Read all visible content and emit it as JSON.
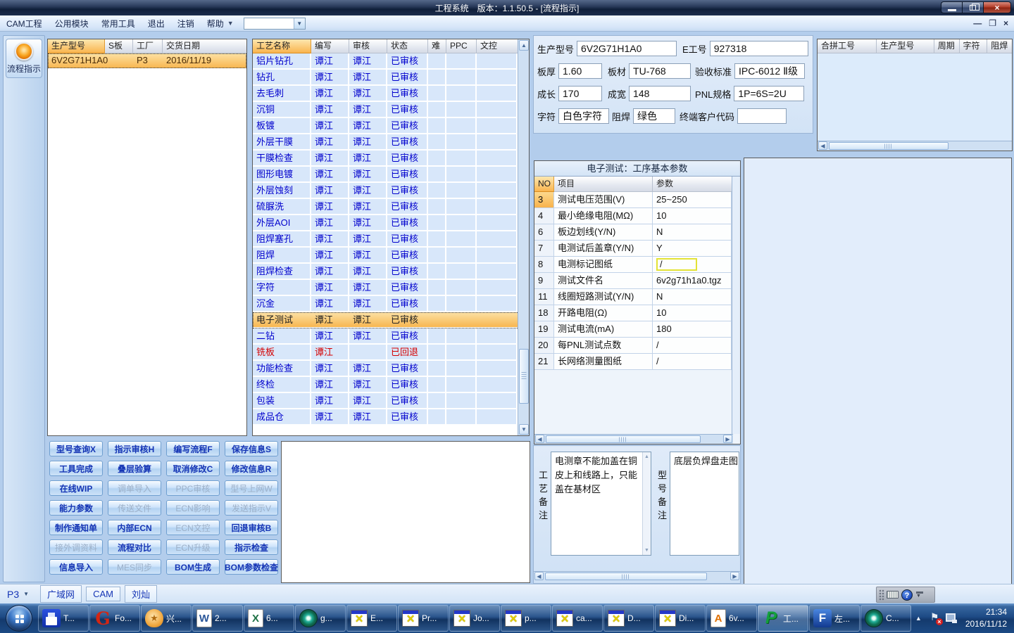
{
  "titlebar": {
    "title": "工程系统　版本：1.1.50.5 - [流程指示]"
  },
  "menubar": {
    "items": [
      "CAM工程",
      "公用模块",
      "常用工具",
      "退出",
      "注销",
      "帮助"
    ]
  },
  "sidebar": {
    "flow_label": "流程指示"
  },
  "model_table": {
    "headers": [
      "生产型号",
      "S板",
      "工厂",
      "交货日期"
    ],
    "row": {
      "model": "6V2G71H1A0",
      "sboard": "",
      "factory": "P3",
      "date": "2016/11/19"
    }
  },
  "process_table": {
    "headers": [
      "工艺名称",
      "编写",
      "审核",
      "状态",
      "难",
      "PPC",
      "文控"
    ],
    "rows": [
      {
        "name": "铝片钻孔",
        "writer": "谭江",
        "auditor": "谭江",
        "status": "已审核",
        "state": "normal"
      },
      {
        "name": "钻孔",
        "writer": "谭江",
        "auditor": "谭江",
        "status": "已审核",
        "state": "normal"
      },
      {
        "name": "去毛刺",
        "writer": "谭江",
        "auditor": "谭江",
        "status": "已审核",
        "state": "normal"
      },
      {
        "name": "沉铜",
        "writer": "谭江",
        "auditor": "谭江",
        "status": "已审核",
        "state": "normal"
      },
      {
        "name": "板镀",
        "writer": "谭江",
        "auditor": "谭江",
        "status": "已审核",
        "state": "normal"
      },
      {
        "name": "外层干膜",
        "writer": "谭江",
        "auditor": "谭江",
        "status": "已审核",
        "state": "normal"
      },
      {
        "name": "干膜检查",
        "writer": "谭江",
        "auditor": "谭江",
        "status": "已审核",
        "state": "normal"
      },
      {
        "name": "图形电镀",
        "writer": "谭江",
        "auditor": "谭江",
        "status": "已审核",
        "state": "normal"
      },
      {
        "name": "外层蚀刻",
        "writer": "谭江",
        "auditor": "谭江",
        "status": "已审核",
        "state": "normal"
      },
      {
        "name": "硫脲洗",
        "writer": "谭江",
        "auditor": "谭江",
        "status": "已审核",
        "state": "normal"
      },
      {
        "name": "外层AOI",
        "writer": "谭江",
        "auditor": "谭江",
        "status": "已审核",
        "state": "normal"
      },
      {
        "name": "阻焊塞孔",
        "writer": "谭江",
        "auditor": "谭江",
        "status": "已审核",
        "state": "normal"
      },
      {
        "name": "阻焊",
        "writer": "谭江",
        "auditor": "谭江",
        "status": "已审核",
        "state": "normal"
      },
      {
        "name": "阻焊检查",
        "writer": "谭江",
        "auditor": "谭江",
        "status": "已审核",
        "state": "normal"
      },
      {
        "name": "字符",
        "writer": "谭江",
        "auditor": "谭江",
        "status": "已审核",
        "state": "normal"
      },
      {
        "name": "沉金",
        "writer": "谭江",
        "auditor": "谭江",
        "status": "已审核",
        "state": "normal"
      },
      {
        "name": "电子测试",
        "writer": "谭江",
        "auditor": "谭江",
        "status": "已审核",
        "state": "selected"
      },
      {
        "name": "二钻",
        "writer": "谭江",
        "auditor": "谭江",
        "status": "已审核",
        "state": "normal"
      },
      {
        "name": "铣板",
        "writer": "谭江",
        "auditor": "",
        "status": "已回退",
        "state": "rejected"
      },
      {
        "name": "功能检查",
        "writer": "谭江",
        "auditor": "谭江",
        "status": "已审核",
        "state": "normal"
      },
      {
        "name": "终检",
        "writer": "谭江",
        "auditor": "谭江",
        "status": "已审核",
        "state": "normal"
      },
      {
        "name": "包装",
        "writer": "谭江",
        "auditor": "谭江",
        "status": "已审核",
        "state": "normal"
      },
      {
        "name": "成品仓",
        "writer": "谭江",
        "auditor": "谭江",
        "status": "已审核",
        "state": "normal"
      }
    ]
  },
  "info_panel": {
    "fields": [
      {
        "label": "生产型号",
        "value": "6V2G71H1A0"
      },
      {
        "label": "E工号",
        "value": "927318"
      },
      {
        "label": "板厚",
        "value": "1.60"
      },
      {
        "label": "板材",
        "value": "TU-768"
      },
      {
        "label": "验收标准",
        "value": "IPC-6012 Ⅱ级"
      },
      {
        "label": "成长",
        "value": "170"
      },
      {
        "label": "成宽",
        "value": "148"
      },
      {
        "label": "PNL规格",
        "value": "1P=6S=2U"
      },
      {
        "label": "字符",
        "value": "白色字符"
      },
      {
        "label": "阻焊",
        "value": "绿色"
      },
      {
        "label": "终端客户代码",
        "value": ""
      }
    ]
  },
  "merge_table": {
    "headers": [
      "合拼工号",
      "生产型号",
      "周期",
      "字符",
      "阻焊"
    ]
  },
  "params_panel": {
    "title": "电子测试：工序基本参数",
    "headers": [
      "NO",
      "项目",
      "参数"
    ],
    "rows": [
      {
        "no": "3",
        "item": "测试电压范围(V)",
        "value": "25~250",
        "no_hl": true
      },
      {
        "no": "4",
        "item": "最小绝缘电阻(MΩ)",
        "value": "10"
      },
      {
        "no": "6",
        "item": "板边划线(Y/N)",
        "value": "N"
      },
      {
        "no": "7",
        "item": "电测试后盖章(Y/N)",
        "value": "Y"
      },
      {
        "no": "8",
        "item": "电测标记图纸",
        "value": "/",
        "value_hl": true
      },
      {
        "no": "9",
        "item": "测试文件名",
        "value": "6v2g71h1a0.tgz"
      },
      {
        "no": "11",
        "item": "线圈短路测试(Y/N)",
        "value": "N"
      },
      {
        "no": "18",
        "item": "开路电阻(Ω)",
        "value": "10"
      },
      {
        "no": "19",
        "item": "测试电流(mA)",
        "value": "180"
      },
      {
        "no": "20",
        "item": "每PNL测试点数",
        "value": "/"
      },
      {
        "no": "21",
        "item": "长网络测量图纸",
        "value": "/"
      }
    ]
  },
  "action_buttons": [
    {
      "label": "型号查询X",
      "enabled": true
    },
    {
      "label": "指示审核H",
      "enabled": true
    },
    {
      "label": "编写流程F",
      "enabled": true
    },
    {
      "label": "保存信息S",
      "enabled": true
    },
    {
      "label": "工具完成",
      "enabled": true
    },
    {
      "label": "叠层验算",
      "enabled": true
    },
    {
      "label": "取消修改C",
      "enabled": true
    },
    {
      "label": "修改信息R",
      "enabled": true
    },
    {
      "label": "在线WIP",
      "enabled": true
    },
    {
      "label": "调单导入",
      "enabled": false
    },
    {
      "label": "PPC审核",
      "enabled": false
    },
    {
      "label": "型号上网W",
      "enabled": false
    },
    {
      "label": "能力参数",
      "enabled": true
    },
    {
      "label": "传送文件",
      "enabled": false
    },
    {
      "label": "ECN影响",
      "enabled": false
    },
    {
      "label": "发送指示V",
      "enabled": false
    },
    {
      "label": "制作通知单",
      "enabled": true
    },
    {
      "label": "内部ECN",
      "enabled": true
    },
    {
      "label": "ECN文控",
      "enabled": false
    },
    {
      "label": "回退审核B",
      "enabled": true
    },
    {
      "label": "接外调资料",
      "enabled": false
    },
    {
      "label": "流程对比",
      "enabled": true
    },
    {
      "label": "ECN升级",
      "enabled": false
    },
    {
      "label": "指示检查",
      "enabled": true
    },
    {
      "label": "信息导入",
      "enabled": true
    },
    {
      "label": "MES同步",
      "enabled": false
    },
    {
      "label": "BOM生成",
      "enabled": true
    },
    {
      "label": "BOM参数检查",
      "enabled": true
    }
  ],
  "remarks": {
    "left_label": "工艺备注",
    "left_text": "电测章不能加盖在铜皮上和线路上，只能盖在基材区",
    "right_label": "型号备注",
    "right_text": "底层负焊盘走图"
  },
  "statusbar": {
    "factory": "P3",
    "tabs": [
      "广域网",
      "CAM",
      "刘灿"
    ]
  },
  "taskbar": {
    "items": [
      {
        "icon": "floppy",
        "label": "T..."
      },
      {
        "icon": "foxmail",
        "label": "Fo..."
      },
      {
        "icon": "shell",
        "label": "兴..."
      },
      {
        "icon": "word",
        "label": "2..."
      },
      {
        "icon": "excel",
        "label": "6..."
      },
      {
        "icon": "cd",
        "label": "g..."
      },
      {
        "icon": "xwin",
        "label": "E..."
      },
      {
        "icon": "xwin",
        "label": "Pr..."
      },
      {
        "icon": "xwin",
        "label": "Jo..."
      },
      {
        "icon": "xwin",
        "label": "p..."
      },
      {
        "icon": "xwin",
        "label": "ca..."
      },
      {
        "icon": "xwin",
        "label": "D..."
      },
      {
        "icon": "xwin",
        "label": "Di..."
      },
      {
        "icon": "adoc",
        "label": "6v..."
      },
      {
        "icon": "pgreen",
        "label": "工...",
        "active": true
      },
      {
        "icon": "fblue",
        "label": "左..."
      },
      {
        "icon": "cd",
        "label": "C..."
      }
    ],
    "clock": {
      "time": "21:34",
      "date": "2016/11/12"
    }
  }
}
